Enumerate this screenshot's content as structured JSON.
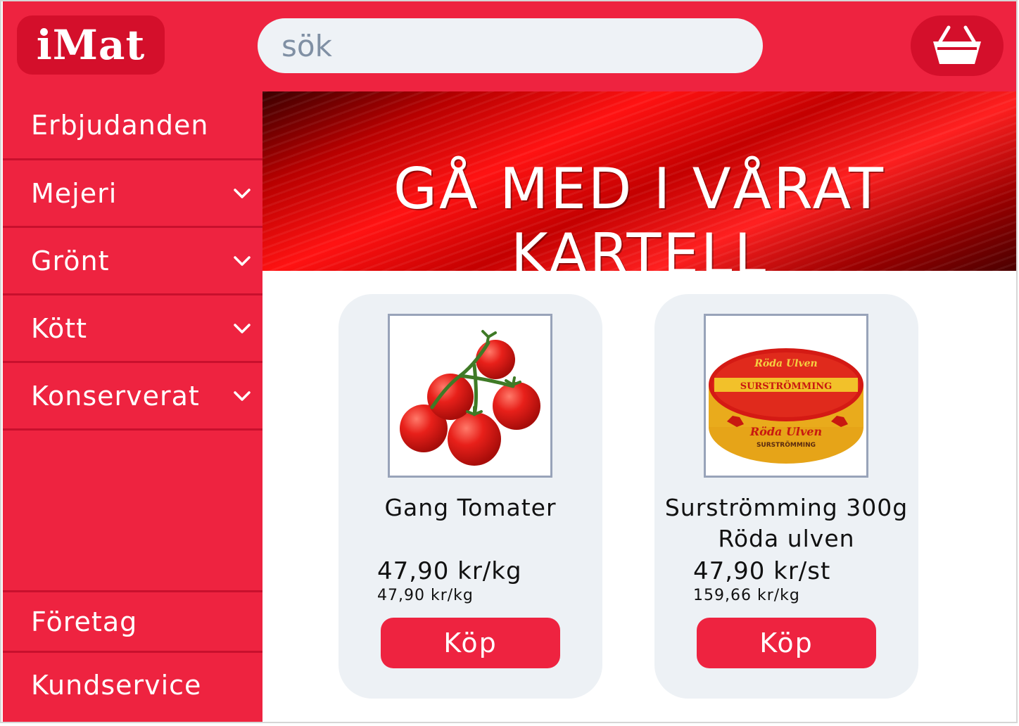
{
  "header": {
    "logo_text": "iMat",
    "search_placeholder": "sök",
    "cart_icon": "shopping-basket-icon"
  },
  "sidebar": {
    "items": [
      {
        "label": "Erbjudanden",
        "has_chevron": false
      },
      {
        "label": "Mejeri",
        "has_chevron": true
      },
      {
        "label": "Grönt",
        "has_chevron": true
      },
      {
        "label": "Kött",
        "has_chevron": true
      },
      {
        "label": "Konserverat",
        "has_chevron": true
      }
    ],
    "bottom_items": [
      {
        "label": "Företag"
      },
      {
        "label": "Kundservice"
      }
    ]
  },
  "banner": {
    "text": "GÅ MED I VÅRAT KARTELL"
  },
  "products": [
    {
      "name": "Gang Tomater",
      "price": "47,90 kr/kg",
      "unit_price": "47,90 kr/kg",
      "buy_label": "Köp",
      "image_icon": "tomato-image"
    },
    {
      "name": "Surströmming 300g Röda ulven",
      "price": "47,90 kr/st",
      "unit_price": "159,66 kr/kg",
      "buy_label": "Köp",
      "image_icon": "surstromming-can-image",
      "image_label_brand": "Röda Ulven",
      "image_label_product": "SURSTRÖMMING"
    }
  ],
  "colors": {
    "brand_red": "#ee2340",
    "dark_red": "#d40f2b",
    "card_bg": "#edf1f5",
    "search_bg": "#eef2f6"
  }
}
